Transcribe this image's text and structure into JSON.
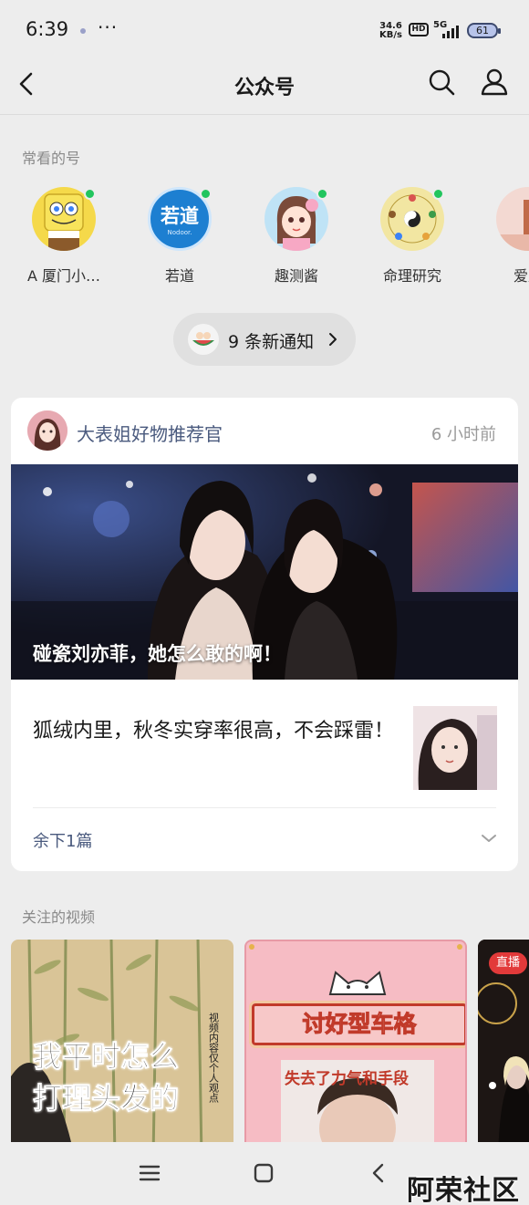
{
  "status": {
    "time": "6:39",
    "more": "···",
    "net_speed_value": "34.6",
    "net_speed_unit": "KB/s",
    "hd": "HD",
    "network": "5G",
    "battery": "61"
  },
  "header": {
    "title": "公众号"
  },
  "frequent": {
    "label": "常看的号",
    "accounts": [
      {
        "name": "A 厦门小…",
        "online": true
      },
      {
        "name": "若道",
        "online": true,
        "logo_text": "若道",
        "logo_sub": "Nodoor."
      },
      {
        "name": "趣测酱",
        "online": true
      },
      {
        "name": "命理研究",
        "online": true
      },
      {
        "name": "爱厦",
        "online": false
      }
    ]
  },
  "notifications": {
    "label": "9 条新通知"
  },
  "article_card": {
    "source": "大表姐好物推荐官",
    "time": "6 小时前",
    "hero_title": "碰瓷刘亦菲，她怎么敢的啊！",
    "second_title": "狐绒内里，秋冬实穿率很高，不会踩雷！",
    "more_label": "余下1篇"
  },
  "videos": {
    "label": "关注的视频",
    "items": [
      {
        "overlay_line1": "我平时怎么",
        "overlay_line2": "打理头发的"
      },
      {
        "banner": "讨好型车格",
        "subtitle": "失去了力气和手段"
      },
      {
        "badge": "直播"
      }
    ]
  },
  "watermark": "阿荣社区"
}
